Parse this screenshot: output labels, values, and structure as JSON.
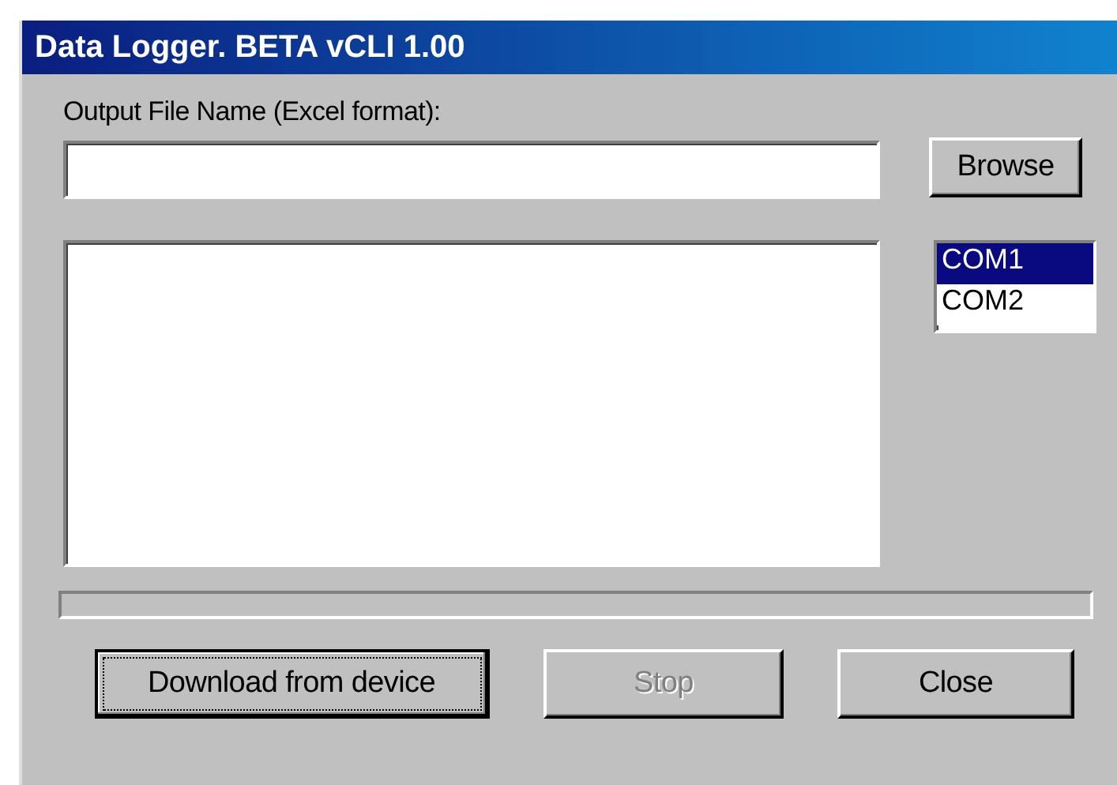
{
  "window": {
    "title": "Data Logger. BETA vCLI 1.00"
  },
  "output_file": {
    "label": "Output File Name (Excel format):"
  },
  "browse_button": {
    "label": "Browse"
  },
  "progress": {
    "level": 0
  },
  "ports": [
    {
      "label": "COM1",
      "selected": true
    },
    {
      "label": "COM2",
      "selected": false
    }
  ],
  "buttons": [
    {
      "label": "Download from device",
      "disabled": false,
      "focused": true
    },
    {
      "label": "Stop",
      "disabled": true,
      "focused": false
    },
    {
      "label": "Close",
      "disabled": false,
      "focused": false
    }
  ]
}
